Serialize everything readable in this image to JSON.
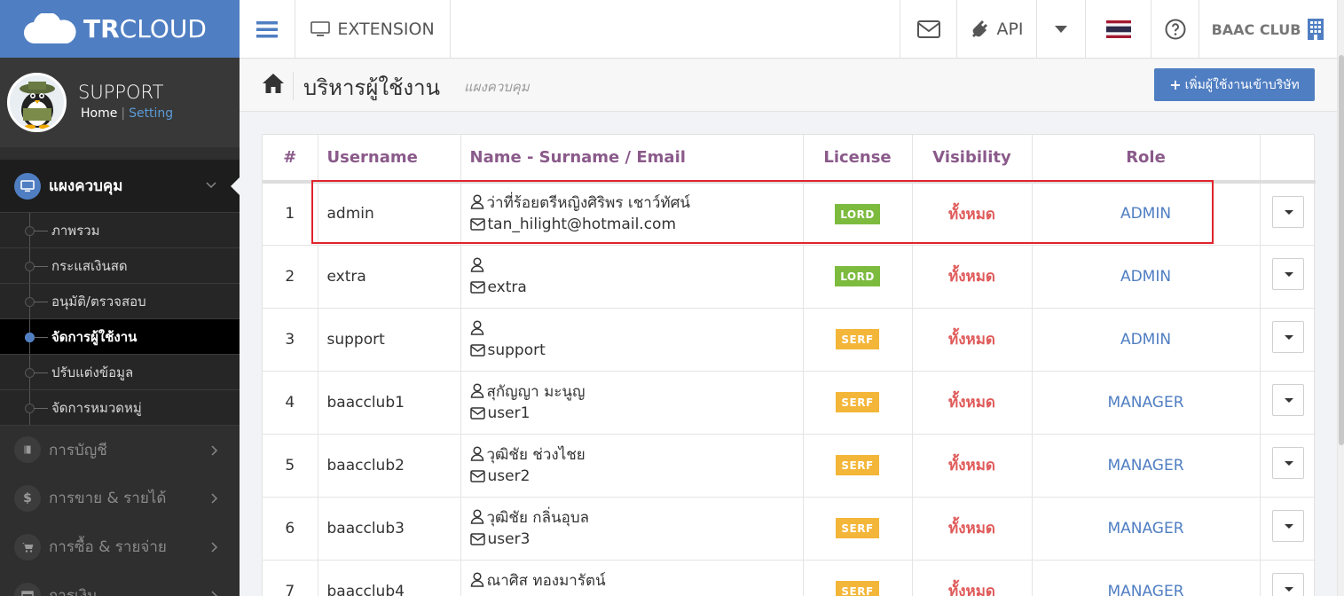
{
  "brand": {
    "logo_bold": "TR",
    "logo_rest": "CLOUD"
  },
  "profile": {
    "name": "SUPPORT",
    "home_link": "Home",
    "separator": "|",
    "setting_link": "Setting"
  },
  "sidebar": {
    "main": {
      "label": "แผงควบคุม"
    },
    "sub_items": [
      {
        "label": "ภาพรวม",
        "active": false
      },
      {
        "label": "กระแสเงินสด",
        "active": false
      },
      {
        "label": "อนุมัติ/ตรวจสอบ",
        "active": false
      },
      {
        "label": "จัดการผู้ใช้งาน",
        "active": true
      },
      {
        "label": "ปรับแต่งข้อมูล",
        "active": false
      },
      {
        "label": "จัดการหมวดหมู่",
        "active": false
      }
    ],
    "sections": [
      {
        "label": "การบัญชี",
        "icon": "book-icon"
      },
      {
        "label": "การขาย & รายได้",
        "icon": "dollar-icon",
        "glyph": "$"
      },
      {
        "label": "การซื้อ & รายจ่าย",
        "icon": "cart-icon"
      },
      {
        "label": "การเงิน",
        "icon": "calendar-icon"
      }
    ]
  },
  "topbar": {
    "extension_label": "EXTENSION",
    "api_label": "API",
    "company_label": "BAAC CLUB"
  },
  "page": {
    "title": "บริหารผู้ใช้งาน",
    "subtitle": "แผงควบคุม",
    "add_button": "เพิ่มผู้ใช้งานเข้าบริษัท"
  },
  "table": {
    "headers": [
      "#",
      "Username",
      "Name - Surname / Email",
      "License",
      "Visibility",
      "Role"
    ],
    "rows": [
      {
        "num": "1",
        "username": "admin",
        "name": "ว่าที่ร้อยตรีหญิงศิริพร เชาว์ทัศน์",
        "email": "tan_hilight@hotmail.com",
        "license": "LORD",
        "visibility": "ทั้งหมด",
        "role": "ADMIN"
      },
      {
        "num": "2",
        "username": "extra",
        "name": "",
        "email": "extra",
        "license": "LORD",
        "visibility": "ทั้งหมด",
        "role": "ADMIN"
      },
      {
        "num": "3",
        "username": "support",
        "name": "",
        "email": "support",
        "license": "SERF",
        "visibility": "ทั้งหมด",
        "role": "ADMIN"
      },
      {
        "num": "4",
        "username": "baacclub1",
        "name": "สุกัญญา มะนูญ",
        "email": "user1",
        "license": "SERF",
        "visibility": "ทั้งหมด",
        "role": "MANAGER"
      },
      {
        "num": "5",
        "username": "baacclub2",
        "name": "วุฒิชัย ช่วงไชย",
        "email": "user2",
        "license": "SERF",
        "visibility": "ทั้งหมด",
        "role": "MANAGER"
      },
      {
        "num": "6",
        "username": "baacclub3",
        "name": "วุฒิชัย กลิ่นอุบล",
        "email": "user3",
        "license": "SERF",
        "visibility": "ทั้งหมด",
        "role": "MANAGER"
      },
      {
        "num": "7",
        "username": "baacclub4",
        "name": "ณาศิส ทองมารัตน์",
        "email": "",
        "license": "SERF",
        "visibility": "ทั้งหมด",
        "role": "MANAGER"
      }
    ]
  },
  "colors": {
    "accent": "#4f7ec2",
    "sidebar_bg": "#2f2f2f",
    "lord": "#7dbb3f",
    "serf": "#f4b638",
    "visibility": "#e05a5a",
    "header_text": "#8a5a8a",
    "highlight": "#e0242c"
  }
}
